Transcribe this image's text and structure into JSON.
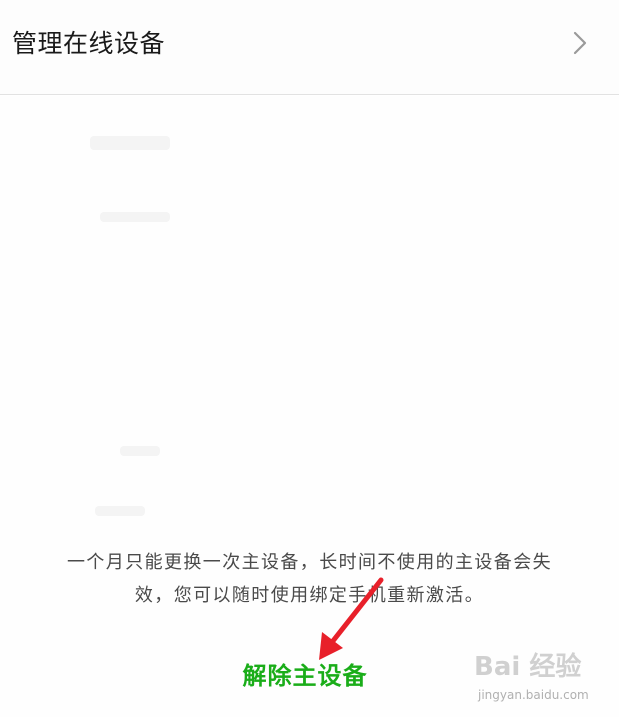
{
  "manage_row": {
    "label": "管理在线设备",
    "chevron_icon": "chevron-right-icon"
  },
  "notice": {
    "line1": "一个月只能更换一次主设备，长时间不使用的主设备会失",
    "line2": "效，您可以随时使用绑定手机重新激活。"
  },
  "release_button": {
    "label": "解除主设备",
    "color": "#1aad19"
  },
  "annotation": {
    "arrow_icon": "red-arrow-icon",
    "color": "#e8202a"
  },
  "watermark": {
    "logo": "Bai 经验",
    "url": "jingyan.baidu.com"
  }
}
